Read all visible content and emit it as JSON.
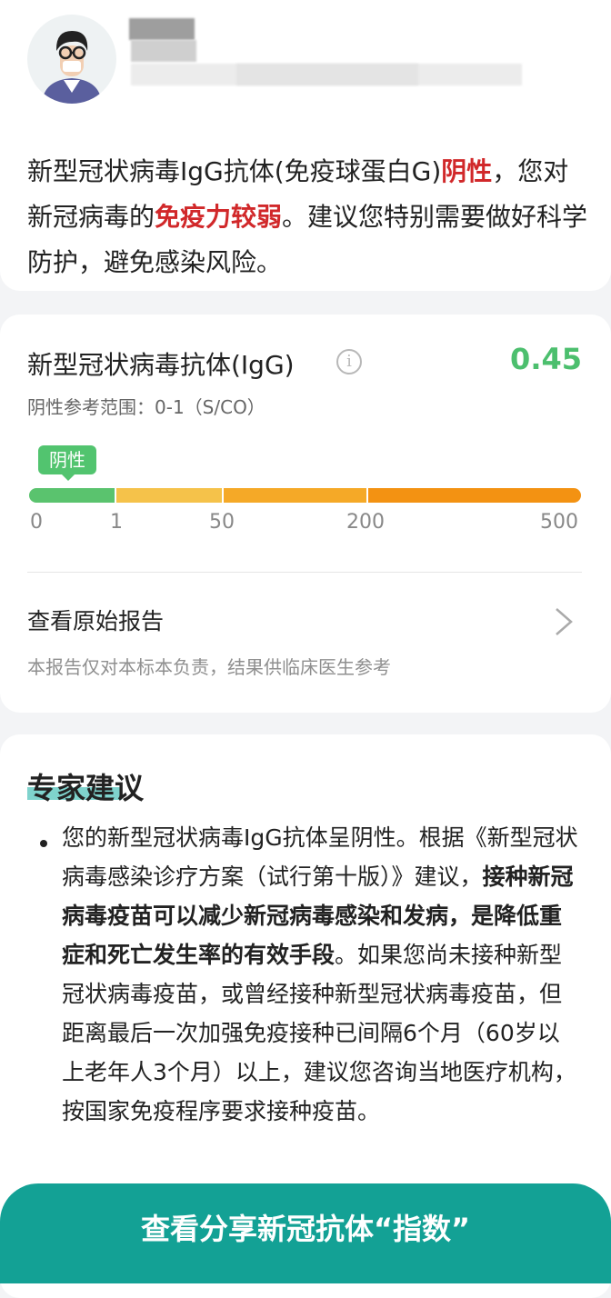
{
  "header": {
    "summary_pre": "新型冠状病毒IgG抗体(免疫球蛋白G)",
    "summary_result": "阴性",
    "summary_mid": "，您对新冠病毒的",
    "summary_immunity": "免疫力较弱",
    "summary_post": "。建议您特别需要做好科学防护，避免感染风险。"
  },
  "result": {
    "title": "新型冠状病毒抗体(IgG)",
    "value": "0.45",
    "value_color": "#4cbf6e",
    "reference": "阴性参考范围：0-1（S/CO）",
    "badge": "阴性",
    "scale_ticks": [
      "0",
      "1",
      "50",
      "200",
      "500"
    ],
    "segment_colors": [
      "#5ac36e",
      "#f5c24a",
      "#f5a927",
      "#f39212"
    ]
  },
  "report": {
    "link_label": "查看原始报告",
    "disclaimer": "本报告仅对本标本负责，结果供临床医生参考"
  },
  "expert": {
    "title": "专家建议",
    "advice_1": "您的新型冠状病毒IgG抗体呈阴性。根据《新型冠状病毒感染诊疗方案（试行第十版）》建议，",
    "advice_bold": "接种新冠病毒疫苗可以减少新冠病毒感染和发病，是降低重症和死亡发生率的有效手段",
    "advice_2": "。如果您尚未接种新型冠状病毒疫苗，或曾经接种新型冠状病毒疫苗，但距离最后一次加强免疫接种已间隔6个月（60岁以上老年人3个月）以上，建议您咨询当地医疗机构，按国家免疫程序要求接种疫苗。"
  },
  "cta": {
    "label": "查看分享新冠抗体“指数”"
  }
}
